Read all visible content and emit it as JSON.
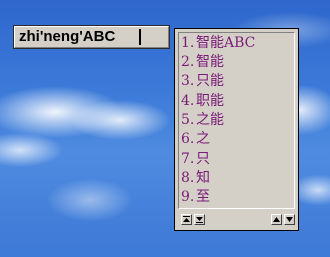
{
  "composition": {
    "text": "zhi'neng'ABC"
  },
  "candidates": [
    {
      "num": "1.",
      "text": "智能ABC"
    },
    {
      "num": "2.",
      "text": "智能"
    },
    {
      "num": "3.",
      "text": "只能"
    },
    {
      "num": "4.",
      "text": "职能"
    },
    {
      "num": "5.",
      "text": "之能"
    },
    {
      "num": "6.",
      "text": "之"
    },
    {
      "num": "7.",
      "text": "只"
    },
    {
      "num": "8.",
      "text": "知"
    },
    {
      "num": "9.",
      "text": "至"
    }
  ],
  "colors": {
    "candidate_text": "#7a1a78",
    "window_face": "#d4d0c8"
  },
  "icons": {
    "first_page": "page-first-icon",
    "last_page": "page-last-icon",
    "prev_page": "page-up-icon",
    "next_page": "page-down-icon"
  }
}
